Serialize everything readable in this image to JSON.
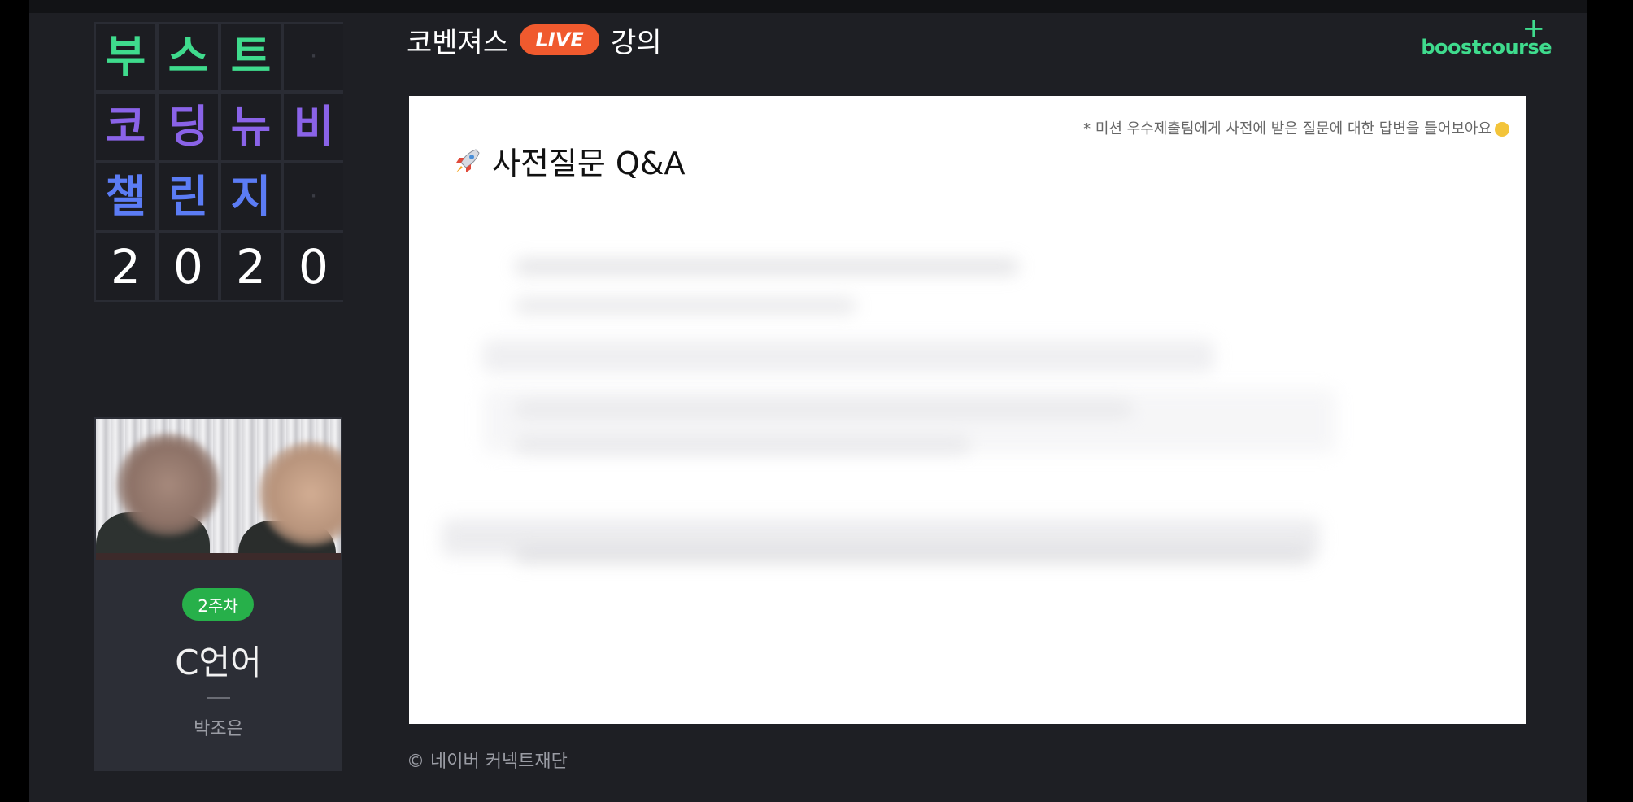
{
  "title_grid": {
    "rows": [
      [
        "부",
        "스",
        "트",
        "·"
      ],
      [
        "코",
        "딩",
        "뉴",
        "비"
      ],
      [
        "챌",
        "린",
        "지",
        "·"
      ],
      [
        "2",
        "0",
        "2",
        "0"
      ]
    ]
  },
  "header": {
    "prefix": "코벤져스",
    "live": "LIVE",
    "suffix": "강의"
  },
  "logo": {
    "plus": "+",
    "text": "boostcourse"
  },
  "sidebar": {
    "week_badge": "2주차",
    "course": "C언어",
    "instructor": "박조은"
  },
  "slide": {
    "note": "* 미션 우수제출팀에게 사전에 받은 질문에 대한 답변을 들어보아요",
    "title": "사전질문 Q&A"
  },
  "footer": {
    "copyright": "© 네이버 커넥트재단"
  },
  "colors": {
    "accent_green": "#3fdb8d",
    "live_orange": "#f05a2e",
    "badge_green": "#27b04a",
    "background": "#1e1f24"
  }
}
